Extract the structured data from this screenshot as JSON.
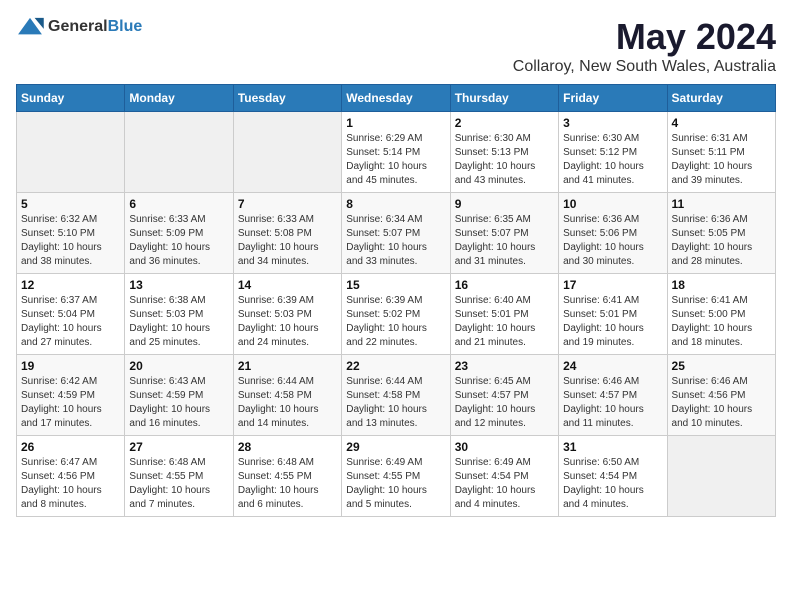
{
  "logo": {
    "general": "General",
    "blue": "Blue"
  },
  "title": "May 2024",
  "subtitle": "Collaroy, New South Wales, Australia",
  "days_header": [
    "Sunday",
    "Monday",
    "Tuesday",
    "Wednesday",
    "Thursday",
    "Friday",
    "Saturday"
  ],
  "weeks": [
    [
      {
        "day": "",
        "info": ""
      },
      {
        "day": "",
        "info": ""
      },
      {
        "day": "",
        "info": ""
      },
      {
        "day": "1",
        "info": "Sunrise: 6:29 AM\nSunset: 5:14 PM\nDaylight: 10 hours\nand 45 minutes."
      },
      {
        "day": "2",
        "info": "Sunrise: 6:30 AM\nSunset: 5:13 PM\nDaylight: 10 hours\nand 43 minutes."
      },
      {
        "day": "3",
        "info": "Sunrise: 6:30 AM\nSunset: 5:12 PM\nDaylight: 10 hours\nand 41 minutes."
      },
      {
        "day": "4",
        "info": "Sunrise: 6:31 AM\nSunset: 5:11 PM\nDaylight: 10 hours\nand 39 minutes."
      }
    ],
    [
      {
        "day": "5",
        "info": "Sunrise: 6:32 AM\nSunset: 5:10 PM\nDaylight: 10 hours\nand 38 minutes."
      },
      {
        "day": "6",
        "info": "Sunrise: 6:33 AM\nSunset: 5:09 PM\nDaylight: 10 hours\nand 36 minutes."
      },
      {
        "day": "7",
        "info": "Sunrise: 6:33 AM\nSunset: 5:08 PM\nDaylight: 10 hours\nand 34 minutes."
      },
      {
        "day": "8",
        "info": "Sunrise: 6:34 AM\nSunset: 5:07 PM\nDaylight: 10 hours\nand 33 minutes."
      },
      {
        "day": "9",
        "info": "Sunrise: 6:35 AM\nSunset: 5:07 PM\nDaylight: 10 hours\nand 31 minutes."
      },
      {
        "day": "10",
        "info": "Sunrise: 6:36 AM\nSunset: 5:06 PM\nDaylight: 10 hours\nand 30 minutes."
      },
      {
        "day": "11",
        "info": "Sunrise: 6:36 AM\nSunset: 5:05 PM\nDaylight: 10 hours\nand 28 minutes."
      }
    ],
    [
      {
        "day": "12",
        "info": "Sunrise: 6:37 AM\nSunset: 5:04 PM\nDaylight: 10 hours\nand 27 minutes."
      },
      {
        "day": "13",
        "info": "Sunrise: 6:38 AM\nSunset: 5:03 PM\nDaylight: 10 hours\nand 25 minutes."
      },
      {
        "day": "14",
        "info": "Sunrise: 6:39 AM\nSunset: 5:03 PM\nDaylight: 10 hours\nand 24 minutes."
      },
      {
        "day": "15",
        "info": "Sunrise: 6:39 AM\nSunset: 5:02 PM\nDaylight: 10 hours\nand 22 minutes."
      },
      {
        "day": "16",
        "info": "Sunrise: 6:40 AM\nSunset: 5:01 PM\nDaylight: 10 hours\nand 21 minutes."
      },
      {
        "day": "17",
        "info": "Sunrise: 6:41 AM\nSunset: 5:01 PM\nDaylight: 10 hours\nand 19 minutes."
      },
      {
        "day": "18",
        "info": "Sunrise: 6:41 AM\nSunset: 5:00 PM\nDaylight: 10 hours\nand 18 minutes."
      }
    ],
    [
      {
        "day": "19",
        "info": "Sunrise: 6:42 AM\nSunset: 4:59 PM\nDaylight: 10 hours\nand 17 minutes."
      },
      {
        "day": "20",
        "info": "Sunrise: 6:43 AM\nSunset: 4:59 PM\nDaylight: 10 hours\nand 16 minutes."
      },
      {
        "day": "21",
        "info": "Sunrise: 6:44 AM\nSunset: 4:58 PM\nDaylight: 10 hours\nand 14 minutes."
      },
      {
        "day": "22",
        "info": "Sunrise: 6:44 AM\nSunset: 4:58 PM\nDaylight: 10 hours\nand 13 minutes."
      },
      {
        "day": "23",
        "info": "Sunrise: 6:45 AM\nSunset: 4:57 PM\nDaylight: 10 hours\nand 12 minutes."
      },
      {
        "day": "24",
        "info": "Sunrise: 6:46 AM\nSunset: 4:57 PM\nDaylight: 10 hours\nand 11 minutes."
      },
      {
        "day": "25",
        "info": "Sunrise: 6:46 AM\nSunset: 4:56 PM\nDaylight: 10 hours\nand 10 minutes."
      }
    ],
    [
      {
        "day": "26",
        "info": "Sunrise: 6:47 AM\nSunset: 4:56 PM\nDaylight: 10 hours\nand 8 minutes."
      },
      {
        "day": "27",
        "info": "Sunrise: 6:48 AM\nSunset: 4:55 PM\nDaylight: 10 hours\nand 7 minutes."
      },
      {
        "day": "28",
        "info": "Sunrise: 6:48 AM\nSunset: 4:55 PM\nDaylight: 10 hours\nand 6 minutes."
      },
      {
        "day": "29",
        "info": "Sunrise: 6:49 AM\nSunset: 4:55 PM\nDaylight: 10 hours\nand 5 minutes."
      },
      {
        "day": "30",
        "info": "Sunrise: 6:49 AM\nSunset: 4:54 PM\nDaylight: 10 hours\nand 4 minutes."
      },
      {
        "day": "31",
        "info": "Sunrise: 6:50 AM\nSunset: 4:54 PM\nDaylight: 10 hours\nand 4 minutes."
      },
      {
        "day": "",
        "info": ""
      }
    ]
  ]
}
